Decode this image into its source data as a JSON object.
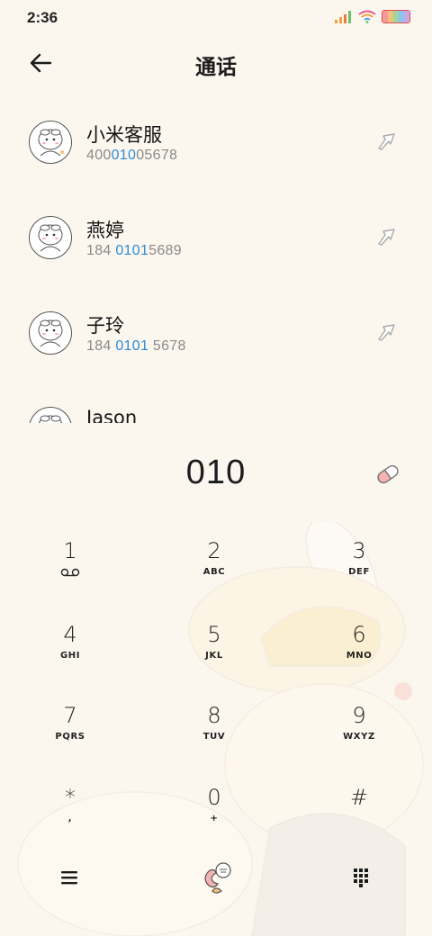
{
  "status": {
    "time": "2:36"
  },
  "header": {
    "title": "通话"
  },
  "contacts": [
    {
      "name": "小米客服",
      "num_pre": "400",
      "num_hl": "010",
      "num_post": "05678"
    },
    {
      "name": "燕婷",
      "num_pre": "184 ",
      "num_hl": "0101",
      "num_post": "5689"
    },
    {
      "name": "子玲",
      "num_pre": "184 ",
      "num_hl": "0101",
      "num_post": " 5678"
    },
    {
      "name": "Jason",
      "num_pre": "",
      "num_hl": "",
      "num_post": ""
    }
  ],
  "dial": {
    "digits": "010"
  },
  "keys": [
    {
      "digit": "1",
      "letters": ""
    },
    {
      "digit": "2",
      "letters": "ABC"
    },
    {
      "digit": "3",
      "letters": "DEF"
    },
    {
      "digit": "4",
      "letters": "GHI"
    },
    {
      "digit": "5",
      "letters": "JKL"
    },
    {
      "digit": "6",
      "letters": "MNO"
    },
    {
      "digit": "7",
      "letters": "PQRS"
    },
    {
      "digit": "8",
      "letters": "TUV"
    },
    {
      "digit": "9",
      "letters": "WXYZ"
    },
    {
      "digit": "*",
      "letters": ","
    },
    {
      "digit": "0",
      "letters": "+"
    },
    {
      "digit": "#",
      "letters": ""
    }
  ],
  "colors": {
    "background": "#fbf6ee",
    "highlight": "#2f8bd8",
    "muted": "#8a8a8a"
  },
  "icons": {
    "back": "arrow-left-icon",
    "call_action": "call-arrow-icon",
    "voicemail": "voicemail-icon",
    "menu": "menu-icon",
    "dialer": "dialer-mascot-icon",
    "keypad_toggle": "keypad-grid-icon"
  }
}
